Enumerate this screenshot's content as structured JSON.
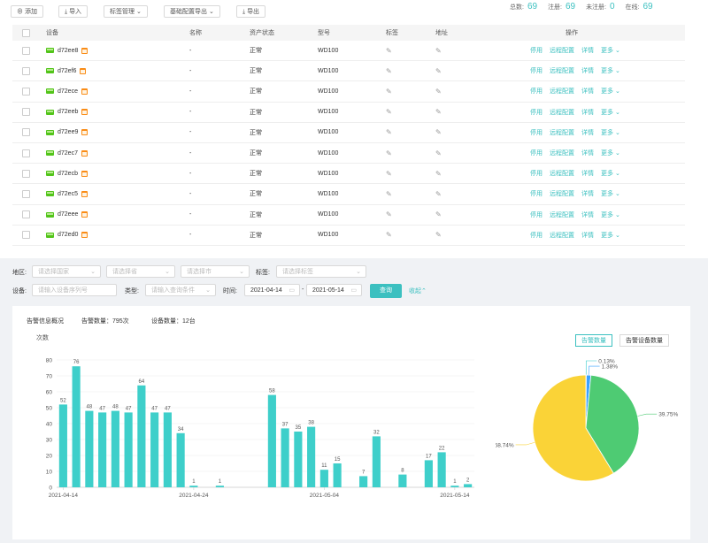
{
  "toolbar": {
    "add": "添加",
    "import": "导入",
    "tag_manage": "标签管理",
    "config_export": "基础配置导出",
    "export": "导出"
  },
  "stats": {
    "total_label": "总数:",
    "total": "69",
    "registered_label": "注册:",
    "registered": "69",
    "unregistered_label": "未注册:",
    "unregistered": "0",
    "online_label": "在线:",
    "online": "69"
  },
  "table": {
    "headers": {
      "device": "设备",
      "name": "名称",
      "state": "资产状态",
      "model": "型号",
      "tag": "标签",
      "address": "地址",
      "ops": "操作"
    },
    "ops": {
      "disable": "停用",
      "remote": "远程配置",
      "detail": "详情",
      "more": "更多"
    },
    "rows": [
      {
        "device": "d72ee8",
        "name": "-",
        "state": "正常",
        "model": "WD100"
      },
      {
        "device": "d72ef6",
        "name": "-",
        "state": "正常",
        "model": "WD100"
      },
      {
        "device": "d72ece",
        "name": "-",
        "state": "正常",
        "model": "WD100"
      },
      {
        "device": "d72eeb",
        "name": "-",
        "state": "正常",
        "model": "WD100"
      },
      {
        "device": "d72ee9",
        "name": "-",
        "state": "正常",
        "model": "WD100"
      },
      {
        "device": "d72ec7",
        "name": "-",
        "state": "正常",
        "model": "WD100"
      },
      {
        "device": "d72ecb",
        "name": "-",
        "state": "正常",
        "model": "WD100"
      },
      {
        "device": "d72ec5",
        "name": "-",
        "state": "正常",
        "model": "WD100"
      },
      {
        "device": "d72eee",
        "name": "-",
        "state": "正常",
        "model": "WD100"
      },
      {
        "device": "d72ed0",
        "name": "-",
        "state": "正常",
        "model": "WD100"
      }
    ]
  },
  "filters": {
    "region_label": "地区:",
    "country_placeholder": "请选择国家",
    "province_placeholder": "请选择省",
    "city_placeholder": "请选择市",
    "tag_label": "标签:",
    "tag_placeholder": "请选择标签",
    "device_label": "设备:",
    "device_placeholder": "请输入设备序列号",
    "type_label": "类型:",
    "type_placeholder": "请输入查询条件",
    "time_label": "时间:",
    "start_date": "2021-04-14",
    "end_date": "2021-05-14",
    "query": "查询",
    "collapse": "收起"
  },
  "summary": {
    "title": "告警信息概况",
    "alarm_count": "告警数量：795次",
    "device_count": "设备数量：12台"
  },
  "toggle": {
    "alarm_count": "告警数量",
    "alarm_devices": "告警设备数量"
  },
  "colors": {
    "accent": "#3cc0c0",
    "bar": "#3ecfca",
    "pie_yellow": "#fad337",
    "pie_green": "#4ecb73",
    "pie_blue": "#36cbcb",
    "pie_teal": "#3aa1ff"
  },
  "chart_data": [
    {
      "type": "bar",
      "ylabel": "次数",
      "ylim": [
        0,
        80
      ],
      "yticks": [
        "0",
        "10",
        "20",
        "30",
        "40",
        "50",
        "60",
        "70",
        "80"
      ],
      "x_tick_labels": [
        "2021-04-14",
        "2021-04-24",
        "2021-05-04",
        "2021-05-14"
      ],
      "values": [
        52,
        76,
        48,
        47,
        48,
        47,
        64,
        47,
        47,
        34,
        1,
        null,
        1,
        null,
        null,
        null,
        58,
        37,
        35,
        38,
        11,
        15,
        null,
        7,
        32,
        null,
        8,
        null,
        17,
        22,
        1,
        2
      ]
    },
    {
      "type": "pie",
      "slices": [
        {
          "label": "58.74%",
          "value": 58.74,
          "color": "#fad337"
        },
        {
          "label": "39.75%",
          "value": 39.75,
          "color": "#4ecb73"
        },
        {
          "label": "1.38%",
          "value": 1.38,
          "color": "#3aa1ff"
        },
        {
          "label": "0.13%",
          "value": 0.13,
          "color": "#36cbcb"
        }
      ]
    }
  ]
}
